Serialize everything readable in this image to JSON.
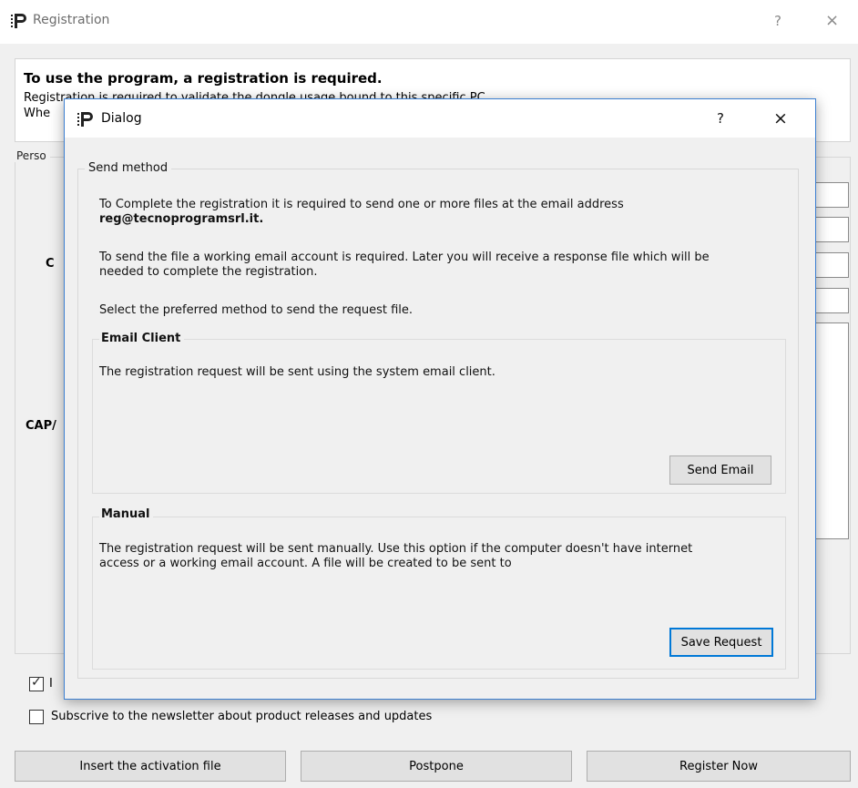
{
  "window": {
    "title": "Registration",
    "help_glyph": "?",
    "close_glyph": "×",
    "logo_icon": "tecnoprogram-p-logo",
    "accent": "#3c7fd1"
  },
  "header": {
    "title": "To use the program, a registration is required.",
    "line2": "Registration is required to validate the dongle usage bound to this specific PC.",
    "line3": "Whe"
  },
  "personal": {
    "title": "Perso",
    "label_c": "C",
    "label_cap": "CAP/"
  },
  "checkboxes": {
    "terms_label": "I",
    "terms_checked": true,
    "newsletter_label": "Subscrive to the newsletter about product releases and updates",
    "newsletter_checked": false,
    "check_glyph": "✓"
  },
  "buttons": {
    "insert": "Insert the activation file",
    "postpone": "Postpone",
    "register": "Register Now"
  },
  "dialog": {
    "title": "Dialog",
    "help_glyph": "?",
    "close_glyph": "×",
    "group_title": "Send method",
    "intro_line1": "To Complete the registration it is required to send one or more files at the email address",
    "intro_email": "reg@tecnoprogramsrl.it.",
    "account_line1": "To send the file a working email account is required. Later you will receive a response file which will be",
    "account_line2": "needed to complete the registration.",
    "select_text": "Select the preferred method to send the request file.",
    "email_client": {
      "title": "Email Client",
      "text": "The registration request will be sent using the system email client.",
      "button": "Send Email"
    },
    "manual": {
      "title": "Manual",
      "text_line1": "The registration request will be sent manually. Use this option if the computer doesn't have internet",
      "text_line2": "access or a working email account. A file will be created to be sent to",
      "button": "Save Request"
    }
  }
}
